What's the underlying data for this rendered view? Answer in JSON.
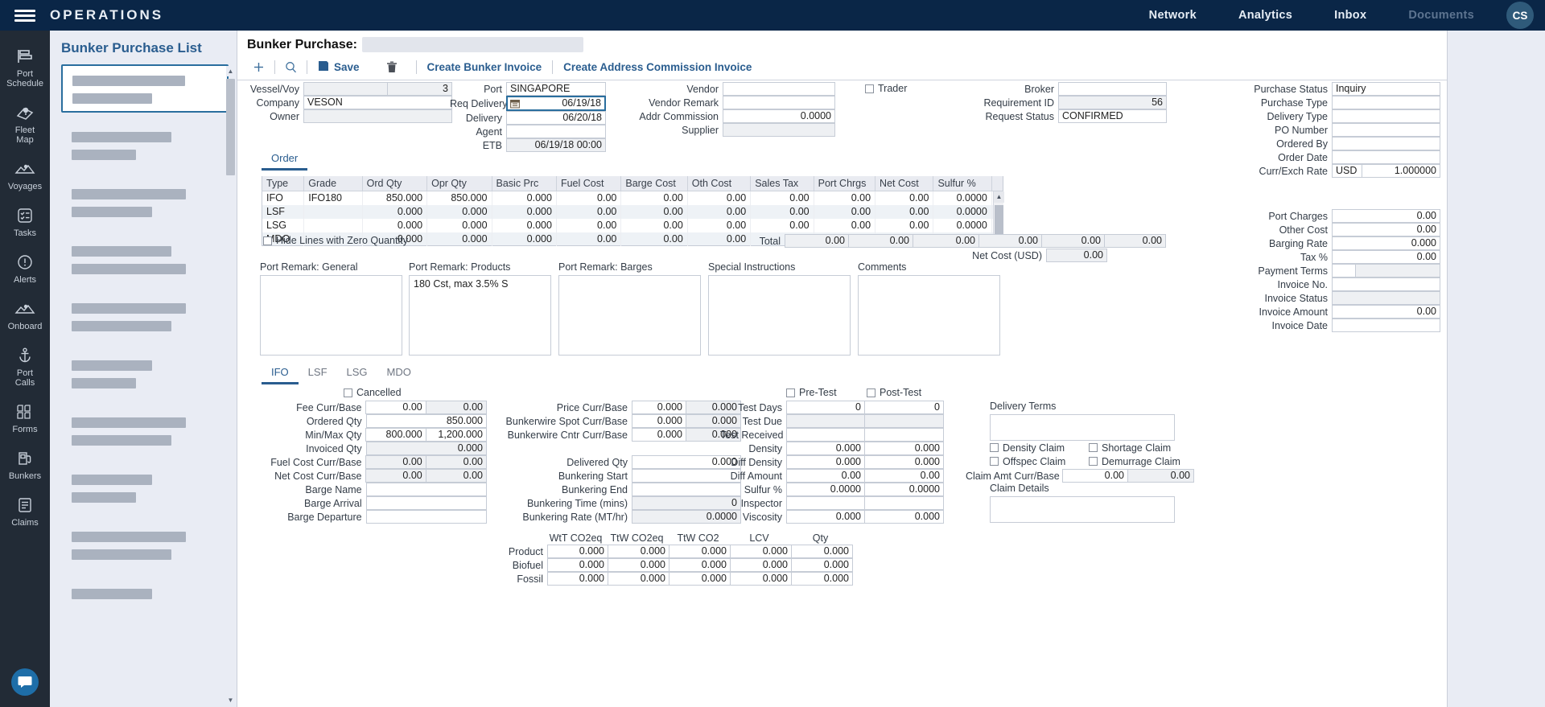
{
  "topbar": {
    "app_title": "OPERATIONS",
    "menu_icon": "hamburger-icon",
    "nav": [
      {
        "label": "Network",
        "dim": false
      },
      {
        "label": "Analytics",
        "dim": false
      },
      {
        "label": "Inbox",
        "dim": false
      },
      {
        "label": "Documents",
        "dim": true
      }
    ],
    "avatar_initials": "CS",
    "bg_color": "#0a2647"
  },
  "rail": {
    "items": [
      {
        "label": "Port\nSchedule",
        "icon": "port-schedule-icon"
      },
      {
        "label": "Fleet\nMap",
        "icon": "fleet-map-icon"
      },
      {
        "label": "Voyages",
        "icon": "voyages-icon"
      },
      {
        "label": "Tasks",
        "icon": "tasks-icon"
      },
      {
        "label": "Alerts",
        "icon": "alerts-icon"
      },
      {
        "label": "Onboard",
        "icon": "onboard-icon"
      },
      {
        "label": "Port\nCalls",
        "icon": "anchor-icon"
      },
      {
        "label": "Forms",
        "icon": "forms-icon"
      },
      {
        "label": "Bunkers",
        "icon": "fuel-pump-icon"
      },
      {
        "label": "Claims",
        "icon": "claims-icon"
      }
    ],
    "chat_icon": "chat-bubble-icon"
  },
  "list_panel": {
    "title": "Bunker Purchase List",
    "selected_index": 0,
    "item_count": 9
  },
  "form": {
    "title": "Bunker Purchase:",
    "title_value": "",
    "toolbar": {
      "add_icon": "plus-icon",
      "search_icon": "search-icon",
      "save_label": "Save",
      "save_icon": "floppy-disk-icon",
      "delete_icon": "trash-icon",
      "create_bunker_invoice": "Create Bunker Invoice",
      "create_address_commission_invoice": "Create Address Commission Invoice"
    },
    "col1": [
      {
        "label": "Vessel/Voy",
        "value": "",
        "value2": "3",
        "readonly": true,
        "split": true
      },
      {
        "label": "Company",
        "value": "VESON",
        "readonly": false
      },
      {
        "label": "Owner",
        "value": "",
        "readonly": true
      }
    ],
    "col2": [
      {
        "label": "Port",
        "value": "SINGAPORE",
        "readonly": false
      },
      {
        "label": "Req Delivery",
        "value": "06/19/18",
        "readonly": false,
        "focused": true,
        "icon": "calendar-icon"
      },
      {
        "label": "Delivery",
        "value": "06/20/18",
        "readonly": false
      },
      {
        "label": "Agent",
        "value": "",
        "readonly": false
      },
      {
        "label": "ETB",
        "value": "06/19/18 00:00",
        "readonly": true
      }
    ],
    "col3": [
      {
        "label": "Vendor",
        "value": "",
        "readonly": false
      },
      {
        "label": "Vendor Remark",
        "value": "",
        "readonly": false
      },
      {
        "label": "Addr Commission",
        "value": "0.0000",
        "readonly": false,
        "num": true
      },
      {
        "label": "Supplier",
        "value": "",
        "readonly": true
      }
    ],
    "trader_checkbox": {
      "label": "Trader",
      "checked": false
    },
    "col4": [
      {
        "label": "Broker",
        "value": "",
        "readonly": false
      },
      {
        "label": "Requirement ID",
        "value": "56",
        "readonly": true,
        "num": true
      },
      {
        "label": "Request Status",
        "value": "CONFIRMED",
        "readonly": false
      }
    ],
    "col5": [
      {
        "label": "Purchase Status",
        "value": "Inquiry",
        "readonly": false
      },
      {
        "label": "Purchase Type",
        "value": "",
        "readonly": false
      },
      {
        "label": "Delivery Type",
        "value": "",
        "readonly": false
      },
      {
        "label": "PO Number",
        "value": "",
        "readonly": false
      },
      {
        "label": "Ordered By",
        "value": "",
        "readonly": false
      },
      {
        "label": "Order Date",
        "value": "",
        "readonly": false
      }
    ],
    "curr_exch": {
      "label": "Curr/Exch Rate",
      "currency": "USD",
      "rate": "1.000000"
    },
    "col5b": [
      {
        "label": "Port Charges",
        "value": "0.00",
        "num": true
      },
      {
        "label": "Other Cost",
        "value": "0.00",
        "num": true
      },
      {
        "label": "Barging Rate",
        "value": "0.000",
        "num": true
      },
      {
        "label": "Tax %",
        "value": "0.00",
        "num": true
      },
      {
        "label": "Payment Terms",
        "value": "",
        "num": false,
        "split": true
      },
      {
        "label": "Invoice No.",
        "value": "",
        "num": false
      },
      {
        "label": "Invoice Status",
        "value": "",
        "num": false,
        "readonly": true
      },
      {
        "label": "Invoice Amount",
        "value": "0.00",
        "num": true
      },
      {
        "label": "Invoice Date",
        "value": "",
        "num": false
      }
    ],
    "order_tab": "Order",
    "grid": {
      "columns": [
        "Type",
        "Grade",
        "Ord Qty",
        "Opr Qty",
        "Basic Prc",
        "Fuel Cost",
        "Barge Cost",
        "Oth Cost",
        "Sales Tax",
        "Port Chrgs",
        "Net Cost",
        "Sulfur %"
      ],
      "rows": [
        [
          "IFO",
          "IFO180",
          "850.000",
          "850.000",
          "0.000",
          "0.00",
          "0.00",
          "0.00",
          "0.00",
          "0.00",
          "0.00",
          "0.0000"
        ],
        [
          "LSF",
          "",
          "0.000",
          "0.000",
          "0.000",
          "0.00",
          "0.00",
          "0.00",
          "0.00",
          "0.00",
          "0.00",
          "0.0000"
        ],
        [
          "LSG",
          "",
          "0.000",
          "0.000",
          "0.000",
          "0.00",
          "0.00",
          "0.00",
          "0.00",
          "0.00",
          "0.00",
          "0.0000"
        ],
        [
          "MDO",
          "",
          "0.000",
          "0.000",
          "0.000",
          "0.00",
          "0.00",
          "0.00",
          "0.00",
          "0.00",
          "0.00",
          "0.0000"
        ]
      ],
      "hide_zero_label": "Hide Lines with Zero Quantity",
      "hide_zero_checked": false,
      "total_label": "Total",
      "totals": [
        "0.00",
        "0.00",
        "0.00",
        "0.00",
        "0.00",
        "0.00"
      ],
      "net_cost_label": "Net Cost (USD)",
      "net_cost_value": "0.00"
    },
    "remarks": [
      {
        "label": "Port Remark: General",
        "value": ""
      },
      {
        "label": "Port Remark: Products",
        "value": "180 Cst, max 3.5% S"
      },
      {
        "label": "Port Remark: Barges",
        "value": ""
      },
      {
        "label": "Special Instructions",
        "value": ""
      },
      {
        "label": "Comments",
        "value": ""
      }
    ],
    "fuel_tabs": [
      {
        "label": "IFO",
        "active": true
      },
      {
        "label": "LSF",
        "active": false
      },
      {
        "label": "LSG",
        "active": false
      },
      {
        "label": "MDO",
        "active": false
      }
    ],
    "cancelled_checkbox": {
      "label": "Cancelled",
      "checked": false
    },
    "detail_left": [
      {
        "label": "Fee Curr/Base",
        "v1": "0.00",
        "v2": "0.00",
        "split": true
      },
      {
        "label": "Ordered Qty",
        "v1": "",
        "v2": "850.000",
        "split": true
      },
      {
        "label": "Min/Max Qty",
        "v1": "800.000",
        "v2": "1,200.000",
        "split": true
      },
      {
        "label": "Invoiced Qty",
        "v1": "",
        "v2": "0.000",
        "split": true
      },
      {
        "label": "Fuel Cost Curr/Base",
        "v1": "0.00",
        "v2": "0.00",
        "split": true
      },
      {
        "label": "Net Cost Curr/Base",
        "v1": "0.00",
        "v2": "0.00",
        "split": true
      },
      {
        "label": "Barge Name",
        "v1": "",
        "v2": "",
        "split": false
      },
      {
        "label": "Barge Arrival",
        "v1": "",
        "v2": "",
        "split": false
      },
      {
        "label": "Barge Departure",
        "v1": "",
        "v2": "",
        "split": false
      }
    ],
    "detail_mid": [
      {
        "label": "Price Curr/Base",
        "v1": "0.000",
        "v2": "0.000",
        "split": true
      },
      {
        "label": "Bunkerwire Spot Curr/Base",
        "v1": "0.000",
        "v2": "0.000",
        "split": true
      },
      {
        "label": "Bunkerwire Cntr Curr/Base",
        "v1": "0.000",
        "v2": "0.000",
        "split": true
      },
      {
        "label": "",
        "v1": "",
        "v2": "",
        "spacer": true
      },
      {
        "label": "Delivered Qty",
        "v1": "",
        "v2": "0.000",
        "split": false
      },
      {
        "label": "Bunkering Start",
        "v1": "",
        "v2": "",
        "split": false
      },
      {
        "label": "Bunkering End",
        "v1": "",
        "v2": "",
        "split": false
      },
      {
        "label": "Bunkering Time (mins)",
        "v1": "",
        "v2": "0",
        "split": false
      },
      {
        "label": "Bunkering Rate (MT/hr)",
        "v1": "",
        "v2": "0.0000",
        "split": false
      }
    ],
    "pre_test": {
      "label": "Pre-Test",
      "checked": false
    },
    "post_test": {
      "label": "Post-Test",
      "checked": false
    },
    "detail_test": [
      {
        "label": "Test Days",
        "v1": "0",
        "v2": "0",
        "ro": false
      },
      {
        "label": "Test Due",
        "v1": "",
        "v2": "",
        "ro": true
      },
      {
        "label": "Test Received",
        "v1": "",
        "v2": "",
        "ro": false
      },
      {
        "label": "Density",
        "v1": "0.000",
        "v2": "0.000",
        "ro": false
      },
      {
        "label": "Diff Density",
        "v1": "0.000",
        "v2": "0.000",
        "ro": false
      },
      {
        "label": "Diff Amount",
        "v1": "0.00",
        "v2": "0.00",
        "ro": false
      },
      {
        "label": "Sulfur %",
        "v1": "0.0000",
        "v2": "0.0000",
        "ro": false
      },
      {
        "label": "Inspector",
        "v1": "",
        "v2": "",
        "ro": false
      },
      {
        "label": "Viscosity",
        "v1": "0.000",
        "v2": "0.000",
        "ro": false
      }
    ],
    "delivery_terms_label": "Delivery Terms",
    "delivery_terms_value": "",
    "claim_checks": [
      {
        "label": "Density Claim",
        "checked": false
      },
      {
        "label": "Shortage Claim",
        "checked": false
      },
      {
        "label": "Offspec Claim",
        "checked": false
      },
      {
        "label": "Demurrage Claim",
        "checked": false
      }
    ],
    "claim_amt_label": "Claim Amt Curr/Base",
    "claim_amt_v1": "0.00",
    "claim_amt_v2": "0.00",
    "claim_details_label": "Claim Details",
    "claim_details_value": "",
    "co2_table": {
      "columns": [
        "WtT CO2eq",
        "TtW CO2eq",
        "TtW CO2",
        "LCV",
        "Qty"
      ],
      "rows": [
        {
          "label": "Product",
          "values": [
            "0.000",
            "0.000",
            "0.000",
            "0.000",
            "0.000"
          ]
        },
        {
          "label": "Biofuel",
          "values": [
            "0.000",
            "0.000",
            "0.000",
            "0.000",
            "0.000"
          ]
        },
        {
          "label": "Fossil",
          "values": [
            "0.000",
            "0.000",
            "0.000",
            "0.000",
            "0.000"
          ]
        }
      ]
    }
  }
}
